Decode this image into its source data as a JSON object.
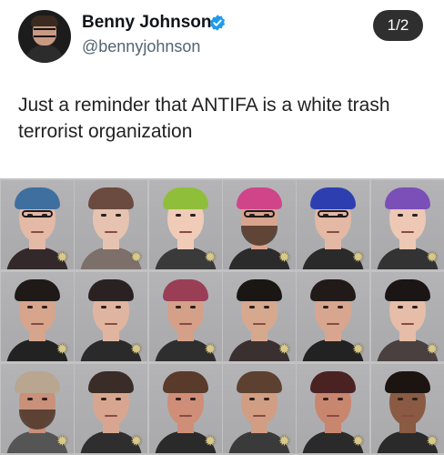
{
  "author": {
    "display_name": "Benny Johnson",
    "handle": "@bennyjohnson",
    "verified": true
  },
  "media": {
    "page_indicator": "1/2"
  },
  "tweet": {
    "text": "Just a reminder that ANTIFA is a white trash terrorist organization"
  },
  "colors": {
    "verified_badge": "#1d9bf0",
    "page_badge_bg": "#2f2f2f"
  },
  "icons": {
    "verified": "verified-check-icon",
    "photo_badge": "sheriff-star-icon"
  }
}
